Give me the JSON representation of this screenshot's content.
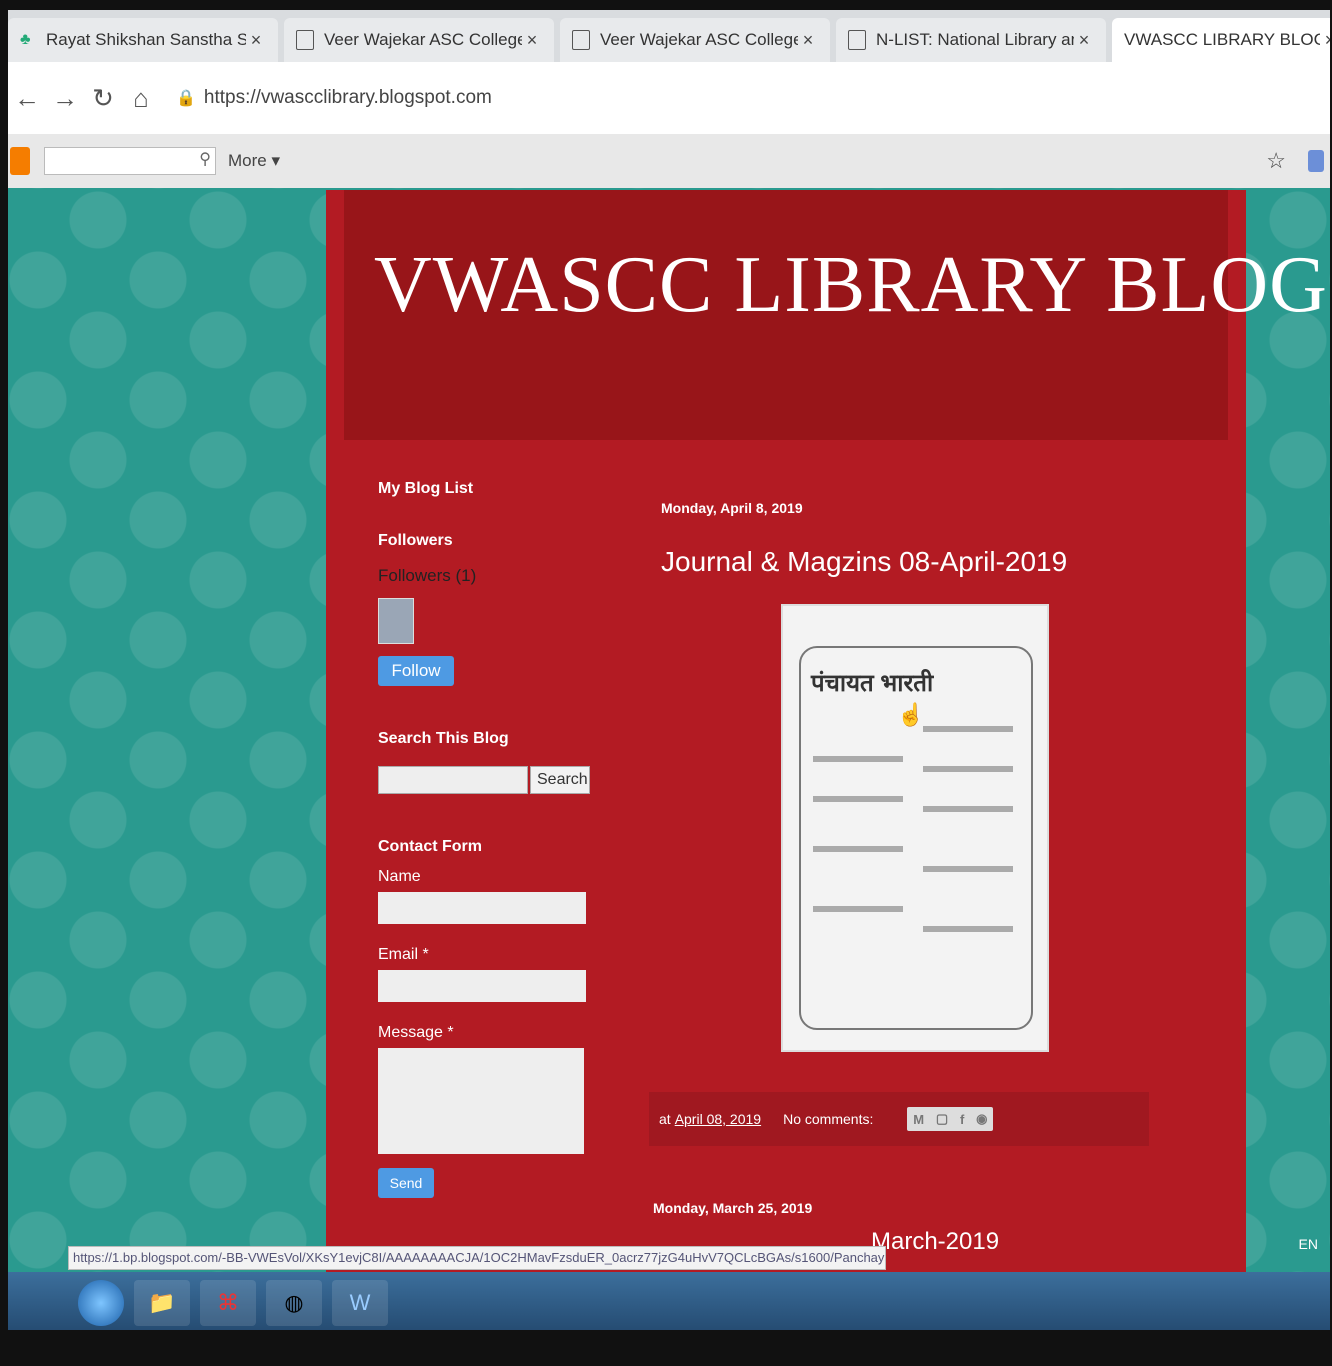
{
  "tabs": [
    {
      "title": "Rayat Shikshan Sanstha Satara |",
      "icon": "leaf-icon",
      "close": "×"
    },
    {
      "title": "Veer Wajekar ASC College Librar",
      "icon": "page-icon",
      "close": "×"
    },
    {
      "title": "Veer Wajekar ASC College Librar",
      "icon": "page-icon",
      "close": "×"
    },
    {
      "title": "N-LIST: National Library and Info",
      "icon": "page-icon",
      "close": "×"
    },
    {
      "title": "VWASCC LIBRARY BLOG",
      "icon": "blogger-icon",
      "close": "×"
    }
  ],
  "address": {
    "url": "https://vwascclibrary.blogspot.com"
  },
  "blogger_nav": {
    "more": "More ▾"
  },
  "blog": {
    "title": "VWASCC LIBRARY BLOG",
    "sidebar": {
      "blog_list_heading": "My Blog List",
      "followers_heading": "Followers",
      "followers_count": "Followers (1)",
      "follow_button": "Follow",
      "search_heading": "Search This Blog",
      "search_button": "Search",
      "contact_heading": "Contact Form",
      "name_label": "Name",
      "email_label": "Email *",
      "message_label": "Message *",
      "send_button": "Send"
    },
    "post": {
      "date": "Monday, April 8, 2019",
      "title": "Journal & Magzins 08-April-2019",
      "image_title": "पंचायत भारती",
      "timestamp_prefix": "at",
      "timestamp": "April 08, 2019",
      "comments": "No comments:"
    },
    "next_post": {
      "date": "Monday, March 25, 2019",
      "title_fragment": "March-2019"
    }
  },
  "status_url": "https://1.bp.blogspot.com/-BB-VWEsVol/XKsY1evjC8I/AAAAAAAACJA/1OC2HMavFzsduER_0acrz77jzG4uHvV7QCLcBGAs/s1600/Panchayat%2BBharti.JPG",
  "tray": {
    "lang": "EN"
  }
}
